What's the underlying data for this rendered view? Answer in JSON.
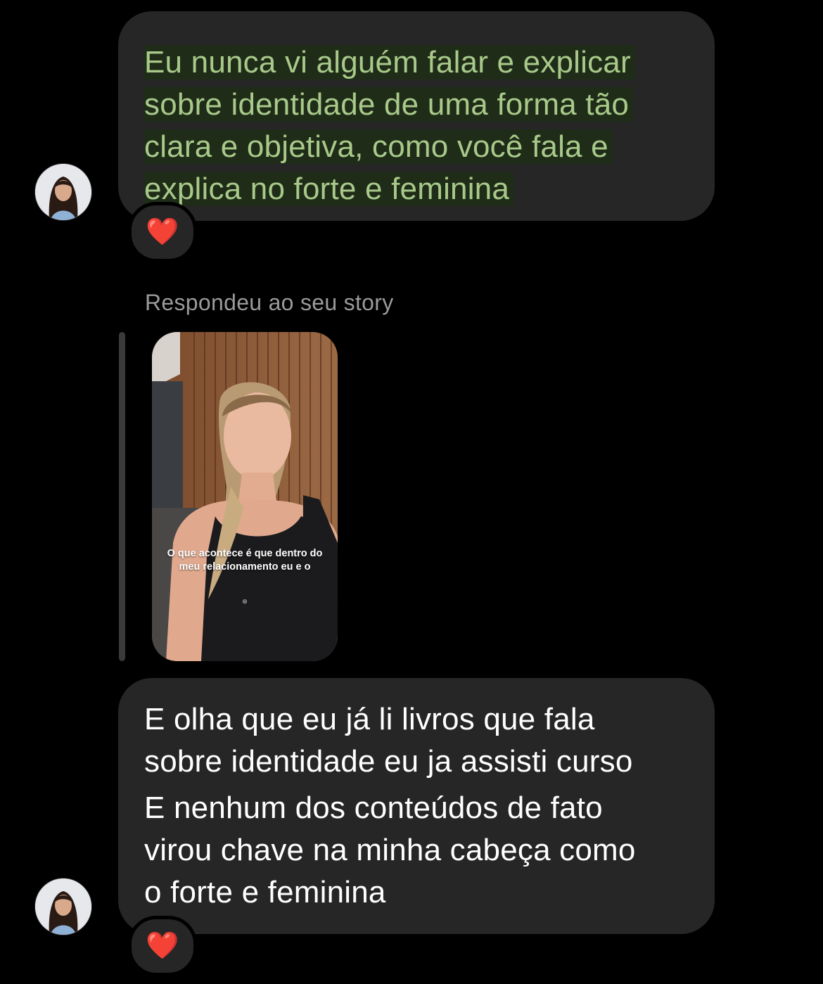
{
  "conversation": {
    "messages": [
      {
        "lines": [
          "Eu nunca vi alguém falar e explicar",
          "sobre identidade de uma forma tão",
          "clara e objetiva, como você fala e",
          "explica no forte e feminina"
        ],
        "highlighted": true,
        "text_color": "#a8c98a",
        "reaction": "❤️"
      },
      {
        "reply_label": "Respondeu ao seu story",
        "story": {
          "caption": "O que acontece é que dentro do meu relacionamento eu e o"
        }
      },
      {
        "text_part_a": "E olha que eu já li livros que fala\nsobre identidade eu ja assisti curso",
        "text_part_b": "E nenhum dos conteúdos de fato\nvirou chave na minha cabeça como\no forte e feminina",
        "text_color": "#ffffff",
        "reaction": "❤️"
      }
    ]
  },
  "colors": {
    "background": "#000000",
    "bubble": "#262626",
    "highlight_text": "#a8c98a",
    "secondary_text": "#9a9a9a",
    "heart": "#e0152a"
  },
  "icons": {
    "reaction": "heart-icon",
    "avatar": "user-avatar"
  }
}
